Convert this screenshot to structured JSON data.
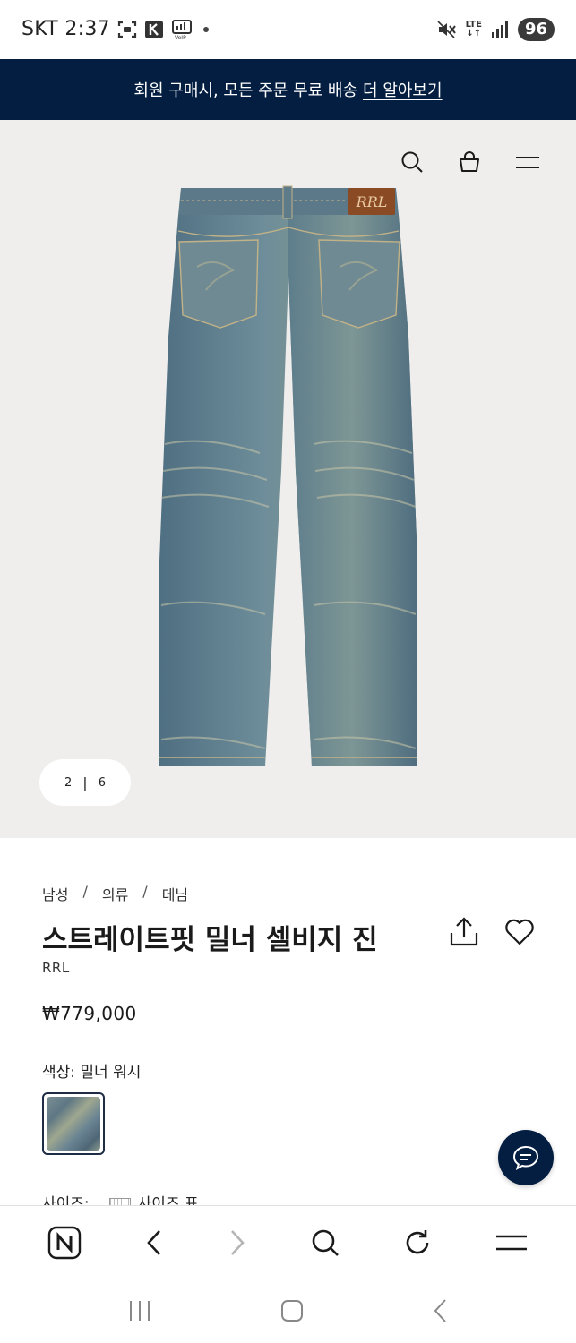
{
  "status_bar": {
    "carrier_time": "SKT 2:37",
    "network": "LTE",
    "battery": "96",
    "icons": [
      "screenshot-icon",
      "k-app-icon",
      "voip-icon",
      "dot-icon",
      "mute-icon",
      "lte-icon",
      "signal-icon"
    ]
  },
  "promo": {
    "text": "회원 구매시, 모든 주문 무료 배송",
    "link": "더 알아보기"
  },
  "header_icons": [
    "search-icon",
    "cart-icon",
    "menu-icon"
  ],
  "gallery": {
    "current": "2",
    "separator": "|",
    "total": "6"
  },
  "breadcrumb": {
    "items": [
      "남성",
      "의류",
      "데님"
    ],
    "separator": "/"
  },
  "product": {
    "title": "스트레이트핏 밀너 셀비지 진",
    "brand": "RRL",
    "price": "₩779,000",
    "color_label": "색상: 밀너 워시",
    "size_label": "사이즈:",
    "size_chart_label": "사이즈 표",
    "logo_patch": "RRL"
  },
  "colors": {
    "navy": "#041e42",
    "hero_bg": "#efeeec",
    "denim": "#5d7a8c"
  },
  "browser_bar_icons": [
    "naver-home-icon",
    "back-icon",
    "forward-icon",
    "search-icon",
    "refresh-icon",
    "menu-icon"
  ],
  "android_nav_icons": [
    "recents-icon",
    "home-icon",
    "back-icon"
  ]
}
